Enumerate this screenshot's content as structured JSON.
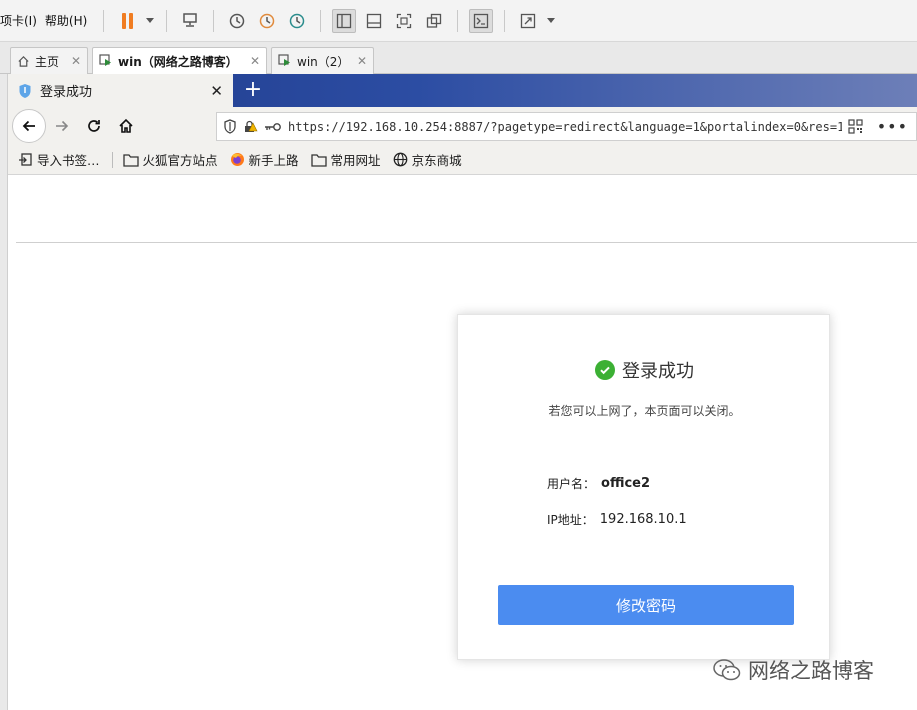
{
  "vm": {
    "menu": [
      {
        "label": "项卡(I)"
      },
      {
        "label": "帮助(H)"
      }
    ],
    "tabs": [
      {
        "label": "主页",
        "icon": "home-icon"
      },
      {
        "label": "win（网络之路博客）",
        "icon": "vm-icon"
      },
      {
        "label": "win（2）",
        "icon": "vm-icon"
      }
    ]
  },
  "browser": {
    "tab": {
      "title": "登录成功"
    },
    "new_tab_label": "+",
    "url": "https://192.168.10.254:8887/?pagetype=redirect&language=1&portalindex=0&res=1",
    "url_menu_label": "•••",
    "bookmarks": [
      {
        "label": "导入书签…",
        "icon": "import-icon"
      },
      {
        "label": "火狐官方站点",
        "icon": "folder-icon"
      },
      {
        "label": "新手上路",
        "icon": "firefox-icon"
      },
      {
        "label": "常用网址",
        "icon": "folder-icon"
      },
      {
        "label": "京东商城",
        "icon": "globe-icon"
      }
    ]
  },
  "page": {
    "title": "登录成功",
    "subtitle": "若您可以上网了，本页面可以关闭。",
    "username_label": "用户名：",
    "username_value": "office2",
    "ip_label": "IP地址：",
    "ip_value": "192.168.10.1",
    "change_password_button": "修改密码"
  },
  "watermark": "网络之路博客",
  "colors": {
    "accent_button": "#4b8cf0",
    "success_check": "#3cb034",
    "pause_orange": "#f07c21",
    "tabbar_blue": "#1f3a8a"
  }
}
